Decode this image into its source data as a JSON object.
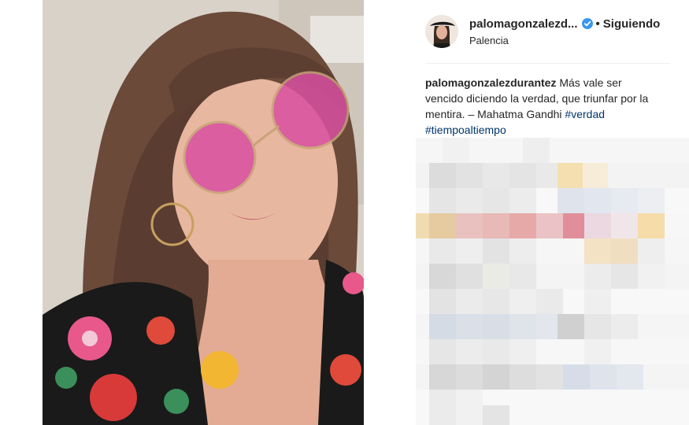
{
  "post": {
    "username": "palomagonzalezd...",
    "follow_status": "Siguiendo",
    "dot": "•",
    "location": "Palencia"
  },
  "caption": {
    "username": "palomagonzalezdurantez",
    "text": "Más vale ser vencido diciendo la verdad, que triunfar por la mentira. – Mahatma Gandhi",
    "hashtags": [
      "#verdad",
      "#tiempoaltiempo"
    ]
  },
  "icons": {
    "verified": "verified-badge-icon",
    "avatar": "avatar"
  },
  "colors": {
    "verified_blue": "#3897f0",
    "hashtag_link": "#003569",
    "text": "#262626"
  }
}
